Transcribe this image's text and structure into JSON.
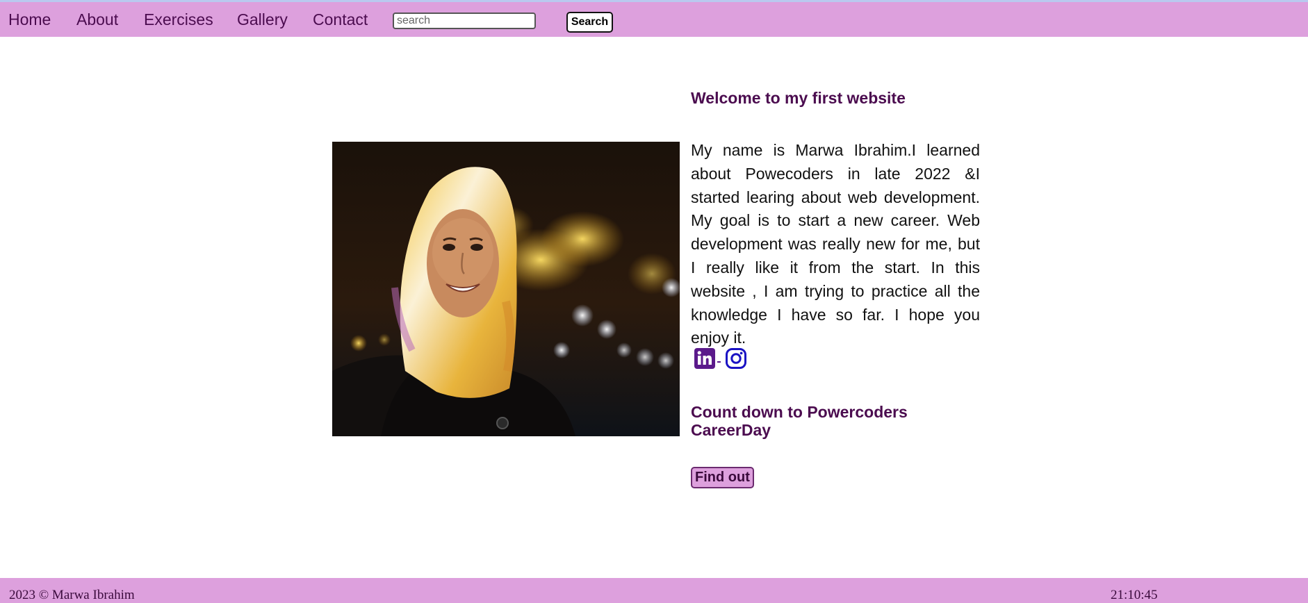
{
  "nav": {
    "items": [
      {
        "label": "Home"
      },
      {
        "label": "About"
      },
      {
        "label": "Exercises"
      },
      {
        "label": "Gallery"
      },
      {
        "label": "Contact"
      }
    ],
    "search_placeholder": "search",
    "search_button": "Search"
  },
  "main": {
    "welcome": "Welcome to my first website",
    "bio": "My name is Marwa Ibrahim.I learned about Powecoders in late 2022 &I started learing about web development. My goal is to start a new career. Web development was really new for me, but I really like it from the start. In this website , I am trying to practice all the knowledge I have so far. I hope you enjoy it.",
    "social": [
      "linkedin-icon",
      "instagram-icon"
    ],
    "countdown_heading": "Count down to Powercoders CareerDay",
    "find_out_button": "Find out"
  },
  "footer": {
    "copyright": "2023 © Marwa Ibrahim",
    "clock": "21:10:45"
  },
  "colors": {
    "accent": "#dda0dd",
    "heading": "#4b0c4f",
    "linkedin": "#5b1a8b",
    "instagram": "#1a12c4"
  }
}
